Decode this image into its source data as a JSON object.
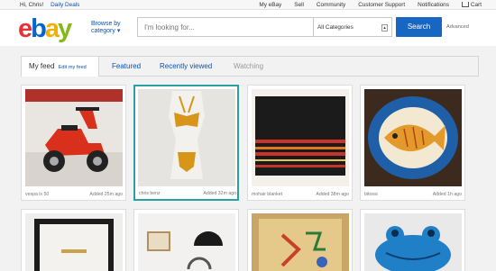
{
  "topbar": {
    "greeting": "Hi, Chris!",
    "daily_deals": "Daily Deals",
    "links": [
      "My eBay",
      "Sell",
      "Community",
      "Customer Support",
      "Notifications",
      "Cart"
    ]
  },
  "header": {
    "logo_letters": [
      "e",
      "b",
      "a",
      "y"
    ],
    "browse_line1": "Browse by",
    "browse_line2": "category",
    "search_placeholder": "I'm looking for...",
    "category_value": "All Categories",
    "search_button": "Search",
    "advanced": "Advanced"
  },
  "tabs": {
    "my_feed": "My feed",
    "edit_feed": "Edit my feed",
    "featured": "Featured",
    "recently_viewed": "Recently viewed",
    "watching": "Watching"
  },
  "cards": [
    {
      "name": "vespa lx 50",
      "added": "Added 25m ago"
    },
    {
      "name": "chris benz",
      "added": "Added 32m ago"
    },
    {
      "name": "mohair blanket",
      "added": "Added 38m ago"
    },
    {
      "name": "bitossi",
      "added": "Added 1h ago"
    }
  ],
  "colors": {
    "brand_red": "#e53238",
    "brand_blue": "#0064d2",
    "brand_yellow": "#f5af02",
    "brand_green": "#86b817",
    "search_button": "#1866c4",
    "link": "#0654ba",
    "highlight_border": "#2aa0a4"
  }
}
